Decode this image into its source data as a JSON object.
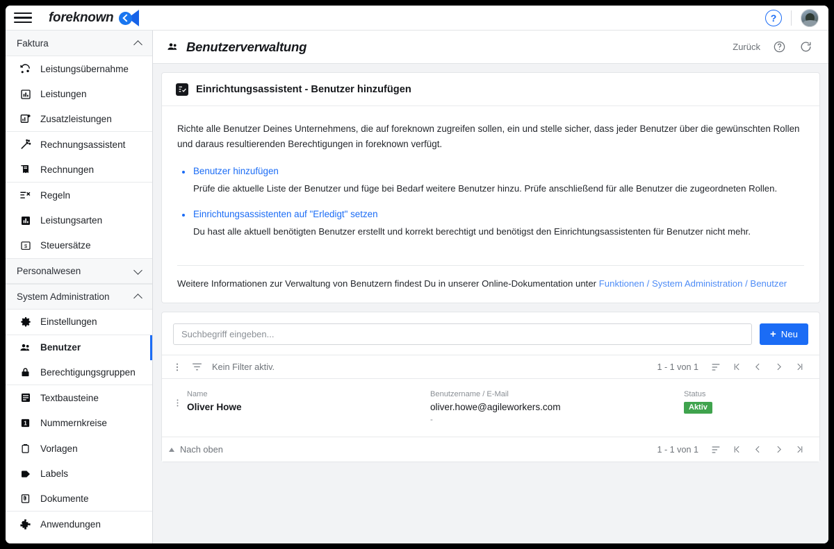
{
  "topbar": {
    "menu_icon": "hamburger-icon",
    "brand": "foreknown",
    "help_icon": "help-circle-icon",
    "avatar_icon": "user-avatar"
  },
  "sidebar": {
    "sections": [
      {
        "label": "Faktura",
        "expanded": true,
        "chevron": "chevron-up-icon",
        "items": [
          {
            "label": "Leistungsübernahme",
            "icon": "sync-icon",
            "active": false,
            "group_end": false
          },
          {
            "label": "Leistungen",
            "icon": "chart-bar-icon",
            "active": false,
            "group_end": false
          },
          {
            "label": "Zusatzleistungen",
            "icon": "chart-bar-plus-icon",
            "active": false,
            "group_end": true
          },
          {
            "label": "Rechnungsassistent",
            "icon": "magic-wand-icon",
            "active": false,
            "group_end": false
          },
          {
            "label": "Rechnungen",
            "icon": "invoice-icon",
            "active": false,
            "group_end": true
          },
          {
            "label": "Regeln",
            "icon": "rules-icon",
            "active": false,
            "group_end": false
          },
          {
            "label": "Leistungsarten",
            "icon": "chart-bar-filled-icon",
            "active": false,
            "group_end": false
          },
          {
            "label": "Steuersätze",
            "icon": "tax-icon",
            "active": false,
            "group_end": false
          }
        ]
      },
      {
        "label": "Personalwesen",
        "expanded": false,
        "chevron": "chevron-down-icon",
        "items": []
      },
      {
        "label": "System Administration",
        "expanded": true,
        "chevron": "chevron-up-icon",
        "items": [
          {
            "label": "Einstellungen",
            "icon": "gear-icon",
            "active": false,
            "group_end": true
          },
          {
            "label": "Benutzer",
            "icon": "users-icon",
            "active": true,
            "group_end": false
          },
          {
            "label": "Berechtigungsgruppen",
            "icon": "lock-icon",
            "active": false,
            "group_end": true
          },
          {
            "label": "Textbausteine",
            "icon": "text-block-icon",
            "active": false,
            "group_end": false
          },
          {
            "label": "Nummernkreise",
            "icon": "number-range-icon",
            "active": false,
            "group_end": false
          },
          {
            "label": "Vorlagen",
            "icon": "clipboard-icon",
            "active": false,
            "group_end": false
          },
          {
            "label": "Labels",
            "icon": "tag-icon",
            "active": false,
            "group_end": false
          },
          {
            "label": "Dokumente",
            "icon": "document-icon",
            "active": false,
            "group_end": true
          },
          {
            "label": "Anwendungen",
            "icon": "puzzle-icon",
            "active": false,
            "group_end": false
          }
        ]
      }
    ]
  },
  "page": {
    "title": "Benutzerverwaltung",
    "title_icon": "users-icon",
    "back_label": "Zurück",
    "help_icon": "help-circle-outline-icon",
    "refresh_icon": "refresh-icon"
  },
  "wizard": {
    "icon": "checklist-icon",
    "heading": "Einrichtungsassistent - Benutzer hinzufügen",
    "intro": "Richte alle Benutzer Deines Unternehmens, die auf foreknown zugreifen sollen, ein und stelle sicher, dass jeder Benutzer über die gewünschten Rollen und daraus resultierenden Berechtigungen in foreknown verfügt.",
    "steps": [
      {
        "link": "Benutzer hinzufügen",
        "desc": "Prüfe die aktuelle Liste der Benutzer und füge bei Bedarf weitere Benutzer hinzu. Prüfe anschließend für alle Benutzer die zugeordneten Rollen."
      },
      {
        "link": "Einrichtungsassistenten auf \"Erledigt\" setzen",
        "desc": "Du hast alle aktuell benötigten Benutzer erstellt und korrekt berechtigt und benötigst den Einrichtungsassistenten für Benutzer nicht mehr."
      }
    ],
    "footer_text": "Weitere Informationen zur Verwaltung von Benutzern findest Du in unserer Online-Dokumentation unter ",
    "footer_link": "Funktionen / System Administration / Benutzer"
  },
  "list": {
    "search_placeholder": "Suchbegriff eingeben...",
    "search_value": "",
    "new_button": "Neu",
    "new_button_icon": "plus-icon",
    "kebab_icon": "more-vertical-icon",
    "filter_icon": "filter-icon",
    "filter_text": "Kein Filter aktiv.",
    "pagination": "1 - 1 von 1",
    "sort_icon": "sort-icon",
    "first_icon": "first-page-icon",
    "prev_icon": "prev-page-icon",
    "next_icon": "next-page-icon",
    "last_icon": "last-page-icon",
    "columns": {
      "name": "Name",
      "username": "Benutzername / E-Mail",
      "status": "Status"
    },
    "rows": [
      {
        "name": "Oliver Howe",
        "username": "oliver.howe@agileworkers.com",
        "sub": "-",
        "status": "Aktiv",
        "status_color": "#3fa34d"
      }
    ],
    "scroll_top_label": "Nach oben",
    "scroll_top_icon": "caret-up-icon"
  },
  "colors": {
    "accent": "#1b6cf5",
    "link": "#4e8cf6",
    "status_active": "#3fa34d",
    "content_bg": "#f2f3f5"
  }
}
